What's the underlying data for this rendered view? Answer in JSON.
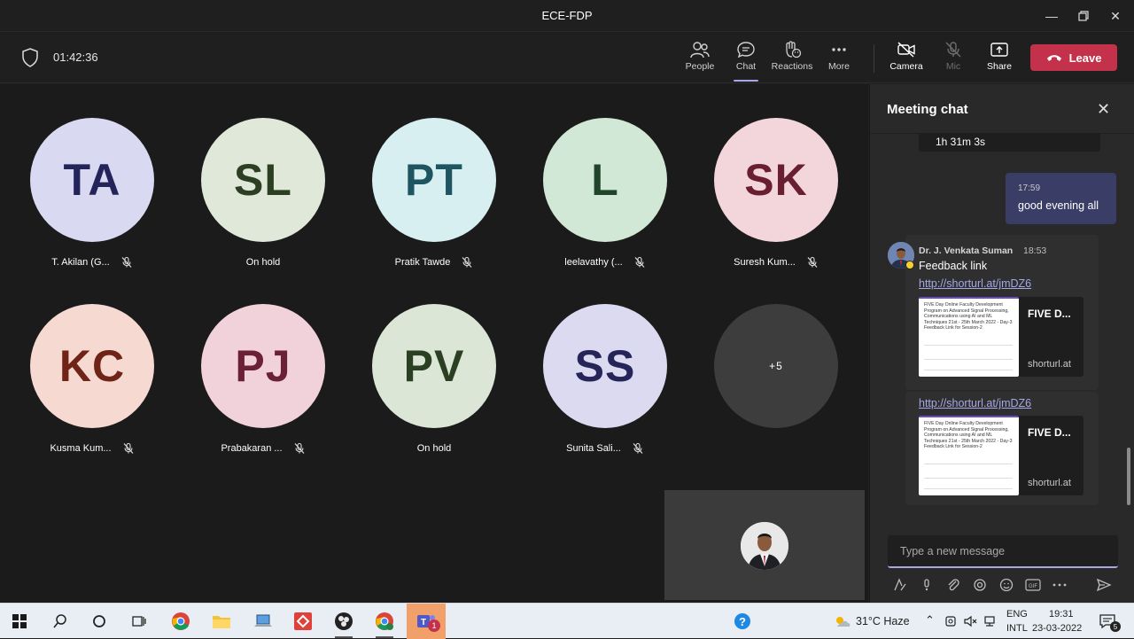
{
  "window": {
    "title": "ECE-FDP"
  },
  "meeting": {
    "timer": "01:42:36"
  },
  "toolbar": {
    "people": "People",
    "chat": "Chat",
    "reactions": "Reactions",
    "more": "More",
    "camera": "Camera",
    "mic": "Mic",
    "share": "Share",
    "leave": "Leave"
  },
  "participants": [
    {
      "initials": "TA",
      "name": "T. Akilan (G...",
      "muted": true,
      "bg": "#dad9f2",
      "fg": "#23245a"
    },
    {
      "initials": "SL",
      "name": "On hold",
      "muted": false,
      "bg": "#dfe8d9",
      "fg": "#2c3f22"
    },
    {
      "initials": "PT",
      "name": "Pratik Tawde",
      "muted": true,
      "bg": "#d8eff2",
      "fg": "#1f5560"
    },
    {
      "initials": "L",
      "name": "leelavathy (...",
      "muted": true,
      "bg": "#d2e8d6",
      "fg": "#20452a"
    },
    {
      "initials": "SK",
      "name": "Suresh Kum...",
      "muted": true,
      "bg": "#f3d6dc",
      "fg": "#6a1f30"
    },
    {
      "initials": "KC",
      "name": "Kusma Kum...",
      "muted": true,
      "bg": "#f6d9d0",
      "fg": "#6e2416"
    },
    {
      "initials": "PJ",
      "name": "Prabakaran ...",
      "muted": true,
      "bg": "#f2d2da",
      "fg": "#6a2036"
    },
    {
      "initials": "PV",
      "name": "On hold",
      "muted": false,
      "bg": "#dbe6d6",
      "fg": "#2b3f22"
    },
    {
      "initials": "SS",
      "name": "Sunita Sali...",
      "muted": true,
      "bg": "#dcdaf0",
      "fg": "#25255a"
    },
    {
      "initials": "+5",
      "name": "",
      "muted": false,
      "bg": "#3d3d3d",
      "fg": "#ffffff"
    }
  ],
  "chat": {
    "title": "Meeting chat",
    "recording_chip": "1h 31m 3s",
    "my_message": {
      "time": "17:59",
      "text": "good evening all"
    },
    "message": {
      "sender": "Dr. J. Venkata Suman",
      "time": "18:53",
      "text": "Feedback link",
      "link1": "http://shorturl.at/jmDZ6",
      "link2": "http://shorturl.at/jmDZ6"
    },
    "preview": {
      "title": "FIVE D...",
      "domain": "shorturl.at",
      "thumb_text": "FIVE Day Online Faculty Development Program on Advanced Signal Processing, Communications using AI and ML Techniques 21st - 25th March 2022 - Day-3 Feedback Link for Session-2"
    },
    "compose_placeholder": "Type a new message"
  },
  "taskbar": {
    "weather": "31°C  Haze",
    "lang1": "ENG",
    "lang2": "INTL",
    "time": "19:31",
    "date": "23-03-2022",
    "teams_badge": "1",
    "notif_count": "5"
  }
}
